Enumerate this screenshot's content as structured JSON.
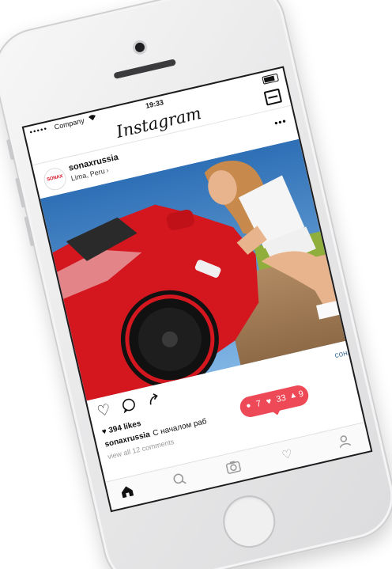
{
  "status_bar": {
    "signal": "●●●●●",
    "carrier": "Company",
    "time": "19:33"
  },
  "app": {
    "title": "Instagram"
  },
  "post": {
    "avatar_text": "SONAX",
    "username": "sonaxrussia",
    "location": "Lima, Peru",
    "likes": "394 likes",
    "caption_user": "sonaxrussia",
    "caption_text": "С началом раб",
    "comments_link": "view all 12 comments",
    "translate_text": "сонакс"
  },
  "icons": {
    "wifi": "wifi-icon",
    "inbox": "inbox-icon",
    "more": "more-icon",
    "like": "heart-outline-icon",
    "comment": "comment-icon",
    "share": "share-icon",
    "home": "home-icon",
    "search": "search-icon",
    "camera": "camera-icon",
    "activity": "heart-icon",
    "profile": "profile-icon"
  },
  "notifications": {
    "comments": "7",
    "likes": "33",
    "follows": "9"
  },
  "colors": {
    "notification_red": "#ed4956",
    "brand_red": "#d7192a",
    "link_blue": "#3f729b",
    "car_red": "#d4161e"
  }
}
